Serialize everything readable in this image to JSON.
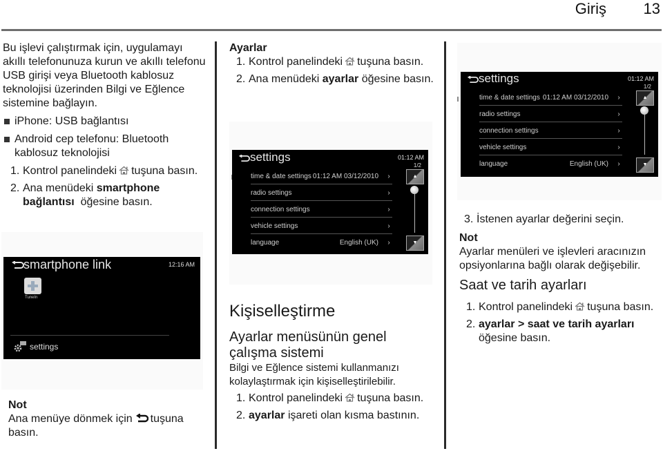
{
  "header": {
    "section": "Giriş",
    "page_number": "13"
  },
  "column1": {
    "intro": "Bu işlevi çalıştırmak için, uygulamayı akıllı telefonunuza kurun ve akıllı telefonu USB girişi veya Bluetooth kablosuz teknolojisi üzerinden Bilgi ve Eğlence sistemine bağlayın.",
    "bullets": [
      "iPhone: USB bağlantısı",
      "Android cep telefonu: Bluetooth kablosuz teknolojisi"
    ],
    "steps": [
      {
        "num": "1.",
        "pre": "Kontrol panelindeki",
        "post": "tuşuna basın."
      },
      {
        "num": "2.",
        "pre": "Ana menüdeki",
        "bold": "smartphone bağlantısı",
        "post": "öğesine basın."
      }
    ],
    "screen": {
      "title": "smartphone link",
      "time": "12:16 AM",
      "app_label": "TuneIn",
      "settings_label": "settings"
    },
    "note": {
      "title": "Not",
      "pre": "Ana menüye dönmek için",
      "post": "tuşuna basın."
    }
  },
  "column2": {
    "heading": "Ayarlar",
    "steps": [
      {
        "num": "1.",
        "pre": "Kontrol panelindeki",
        "post": "tuşuna basın."
      },
      {
        "num": "2.",
        "pre": "Ana menüdeki",
        "bold": "ayarlar",
        "post": "öğesine basın."
      }
    ],
    "screen": {
      "title": "settings",
      "time": "01:12 AM",
      "page": "1/2",
      "rows": [
        {
          "label": "time & date settings",
          "value": "01:12 AM   03/12/2010",
          "chevron": "›"
        },
        {
          "label": "radio settings",
          "value": "",
          "chevron": "›"
        },
        {
          "label": "connection settings",
          "value": "",
          "chevron": "›"
        },
        {
          "label": "vehicle settings",
          "value": "",
          "chevron": "›"
        },
        {
          "label": "language",
          "value": "English (UK)",
          "chevron": "›"
        }
      ],
      "scroll_up": "▲",
      "scroll_down": "▼"
    },
    "section_title": "Kişiselleştirme",
    "subsection_title": "Ayarlar menüsünün genel çalışma sistemi",
    "body": "Bilgi ve Eğlence sistemi kullanmanızı kolaylaştırmak için kişiselleştirilebilir.",
    "steps2": [
      {
        "num": "1.",
        "pre": "Kontrol panelindeki",
        "post": "tuşuna basın."
      },
      {
        "num": "2.",
        "bold": "ayarlar",
        "post": "işareti olan kısma bastının."
      }
    ]
  },
  "column3": {
    "screen": {
      "title": "settings",
      "time": "01:12 AM",
      "page": "1/2",
      "rows": [
        {
          "label": "time & date settings",
          "value": "01:12 AM   03/12/2010",
          "chevron": "›"
        },
        {
          "label": "radio settings",
          "value": "",
          "chevron": "›"
        },
        {
          "label": "connection settings",
          "value": "",
          "chevron": "›"
        },
        {
          "label": "vehicle settings",
          "value": "",
          "chevron": "›"
        },
        {
          "label": "language",
          "value": "English (UK)",
          "chevron": "›"
        }
      ],
      "scroll_up": "▲",
      "scroll_down": "▼"
    },
    "step3": {
      "num": "3.",
      "text": "İstenen ayarlar değerini seçin."
    },
    "note": {
      "title": "Not",
      "text": "Ayarlar menüleri ve işlevleri aracınızın opsiyonlarına bağlı olarak değişebilir."
    },
    "subsection_title": "Saat ve tarih ayarları",
    "steps": [
      {
        "num": "1.",
        "pre": "Kontrol panelindeki",
        "post": "tuşuna basın."
      },
      {
        "num": "2.",
        "bold": "ayarlar > saat ve tarih ayarları",
        "post": "öğesine basın."
      }
    ]
  }
}
